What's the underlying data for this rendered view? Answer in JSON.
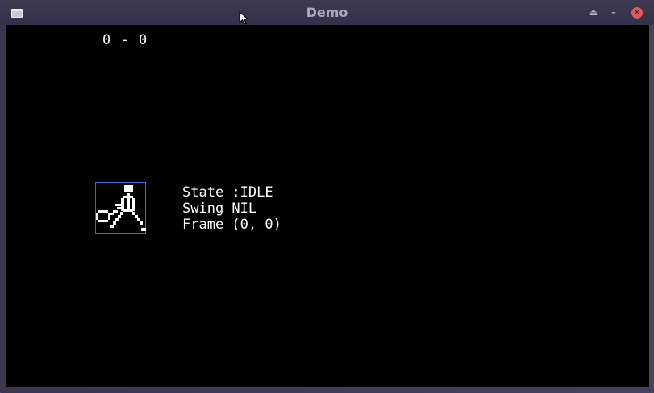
{
  "window": {
    "title": "Demo"
  },
  "titlebar_buttons": {
    "shade_glyph": "⏏",
    "minimize_glyph": "–",
    "close_glyph": "✕"
  },
  "icons": {
    "window_menu": "window-icon",
    "shade": "shade-icon",
    "minimize": "minimize-icon",
    "close": "close-icon",
    "cursor": "mouse-pointer-icon",
    "player": "tennis-player-sprite"
  },
  "colors": {
    "canvas_bg": "#000000",
    "text": "#ffffff",
    "sprite_bbox": "#3a6ad8",
    "close_button": "#e05a5a"
  },
  "game": {
    "score": "0 - 0",
    "state_text": "State :IDLE",
    "swing_text": "Swing NIL",
    "frame_text": "Frame (0, 0)"
  }
}
